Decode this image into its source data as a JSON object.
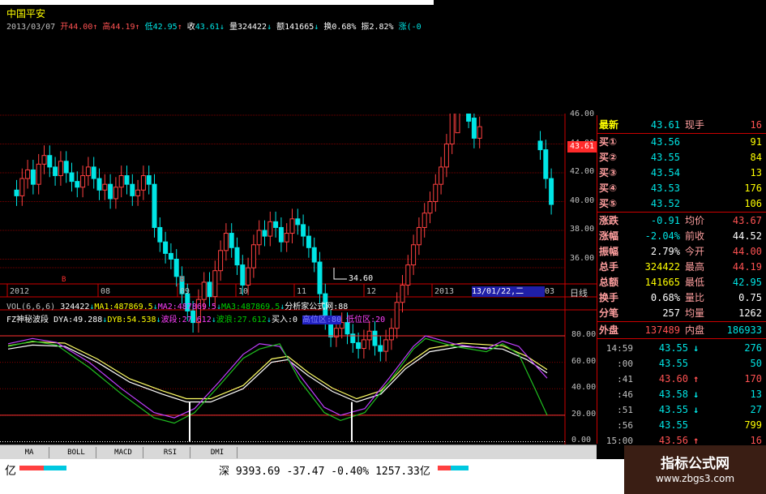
{
  "header": {
    "stock_name": "中国平安",
    "date": "2013/03/07",
    "open_label": "开",
    "open": "44.00",
    "high_label": "高",
    "high": "44.19",
    "low_label": "低",
    "low": "42.95",
    "close_label": "收",
    "close": "43.61",
    "vol_label": "量",
    "vol": "324422",
    "amt_label": "额",
    "amt": "141665",
    "turn_label": "换",
    "turn": "0.68%",
    "amp_label": "振",
    "amp": "2.82%",
    "chg_label": "涨",
    "chg": "(-0"
  },
  "price_axis": {
    "ticks": [
      "46.00",
      "44.00",
      "42.00",
      "40.00",
      "38.00",
      "36.00"
    ],
    "current_price": "43.61",
    "low_annotation": "34.60"
  },
  "time_axis": {
    "labels": [
      "2012",
      "08",
      "09",
      "10",
      "11",
      "12",
      "2013"
    ],
    "selected_date": "13/01/22,二",
    "last": "03",
    "period": "日线"
  },
  "vol_line": {
    "title": "VOL(6,6,6)",
    "vol": "324422",
    "ma1": "MA1:487869.5",
    "ma2": "MA2:487869.5",
    "ma3": "MA3:487869.5",
    "source": "分析家公式网:88"
  },
  "indicator_line": {
    "name": "FZ神秘波段",
    "dya": "DYA:49.288",
    "dyb": "DYB:54.538",
    "wave1": "波段:27.612",
    "wave2": "波浪:27.612",
    "buy": "买入:0",
    "high_zone": "高位区:80",
    "low_zone": "低位区:20"
  },
  "indicator_axis": [
    "80.00",
    "60.00",
    "40.00",
    "20.00",
    "0.00"
  ],
  "indicator_tabs": [
    "MA",
    "BOLL",
    "MACD",
    "RSI",
    "DMI"
  ],
  "quote": {
    "latest_label": "最新",
    "latest": "43.61",
    "now_hand_label": "现手",
    "now_hand": "16",
    "bids": [
      {
        "label": "买①",
        "price": "43.56",
        "qty": "91"
      },
      {
        "label": "买②",
        "price": "43.55",
        "qty": "84"
      },
      {
        "label": "买③",
        "price": "43.54",
        "qty": "13"
      },
      {
        "label": "买④",
        "price": "43.53",
        "qty": "176"
      },
      {
        "label": "买⑤",
        "price": "43.52",
        "qty": "106"
      }
    ],
    "stats": [
      {
        "l1": "涨跌",
        "v1": "-0.91",
        "c1": "#00e5e5",
        "l2": "均价",
        "v2": "43.67",
        "c2": "#ff5252"
      },
      {
        "l1": "涨幅",
        "v1": "-2.04%",
        "c1": "#00e5e5",
        "l2": "前收",
        "v2": "44.52",
        "c2": "#ffffff"
      },
      {
        "l1": "振幅",
        "v1": "2.79%",
        "c1": "#ffffff",
        "l2": "今开",
        "v2": "44.00",
        "c2": "#ff5252"
      },
      {
        "l1": "总手",
        "v1": "324422",
        "c1": "#ffff00",
        "l2": "最高",
        "v2": "44.19",
        "c2": "#ff5252"
      },
      {
        "l1": "总额",
        "v1": "141665",
        "c1": "#ffff00",
        "l2": "最低",
        "v2": "42.95",
        "c2": "#00e5e5"
      },
      {
        "l1": "换手",
        "v1": "0.68%",
        "c1": "#ffffff",
        "l2": "量比",
        "v2": "0.75",
        "c2": "#ffffff"
      },
      {
        "l1": "分笔",
        "v1": "257",
        "c1": "#ffffff",
        "l2": "均量",
        "v2": "1262",
        "c2": "#ffffff"
      }
    ],
    "outer_label": "外盘",
    "outer": "137489",
    "inner_label": "内盘",
    "inner": "186933"
  },
  "ticks": [
    {
      "time": "14:59",
      "price": "43.55",
      "dir": "↓",
      "dcol": "#00e5e5",
      "vol": "276",
      "vcol": "#00e5e5"
    },
    {
      "time": ":00",
      "price": "43.55",
      "dir": "",
      "dcol": "#00e5e5",
      "vol": "50",
      "vcol": "#00e5e5"
    },
    {
      "time": ":41",
      "price": "43.60",
      "dir": "↑",
      "dcol": "#ff5252",
      "vol": "170",
      "vcol": "#ff5252"
    },
    {
      "time": ":46",
      "price": "43.58",
      "dir": "↓",
      "dcol": "#00e5e5",
      "vol": "13",
      "vcol": "#00e5e5"
    },
    {
      "time": ":51",
      "price": "43.55",
      "dir": "↓",
      "dcol": "#00e5e5",
      "vol": "27",
      "vcol": "#00e5e5"
    },
    {
      "time": ":56",
      "price": "43.55",
      "dir": "",
      "dcol": "#00e5e5",
      "vol": "799",
      "vcol": "#ffff00"
    },
    {
      "time": "15:00",
      "price": "43.56",
      "dir": "↑",
      "dcol": "#ff5252",
      "vol": "16",
      "vcol": "#ff5252"
    }
  ],
  "status": {
    "left_unit": "亿",
    "market": "深",
    "index": "9393.69",
    "change": "-37.47",
    "pct": "-0.40%",
    "amount": "1257.33亿"
  },
  "brand": {
    "title": "指标公式网",
    "url": "www.zbgs3.com"
  },
  "colors": {
    "up": "#ff4040",
    "down": "#00e5e5",
    "grid": "#9b0000",
    "dya": "#ffffff",
    "dyb": "#ffff66",
    "wave1": "#c040ff",
    "wave2": "#20c020"
  }
}
